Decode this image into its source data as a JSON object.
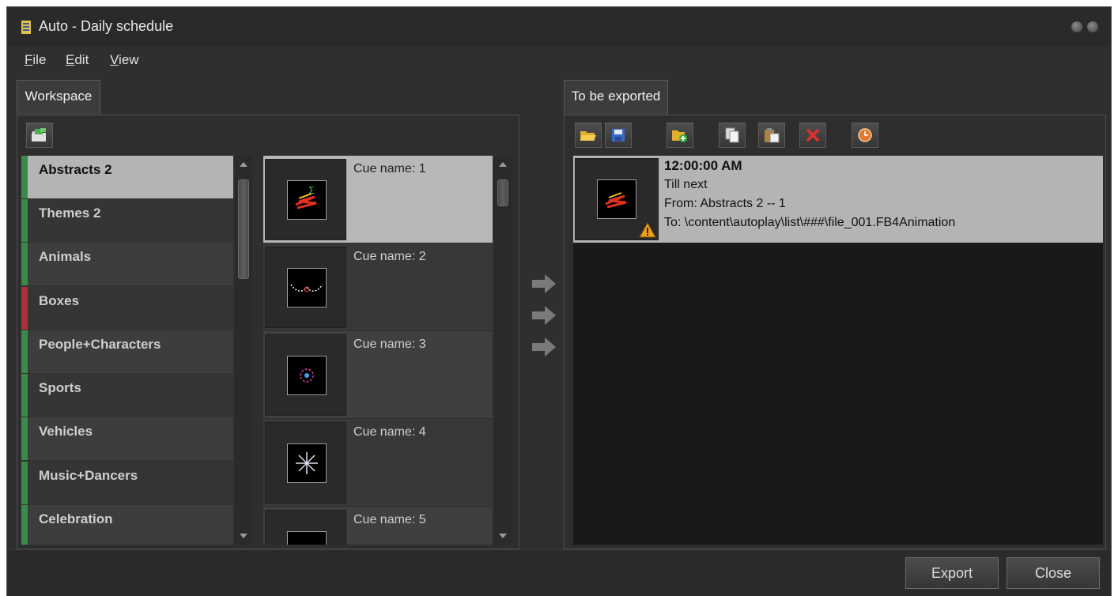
{
  "window": {
    "title": "Auto - Daily schedule",
    "icon": "app-icon",
    "controls": [
      "minimize-icon",
      "close-icon"
    ]
  },
  "menu": [
    {
      "label": "File",
      "mnemonic": "F",
      "rest": "ile"
    },
    {
      "label": "Edit",
      "mnemonic": "E",
      "rest": "dit"
    },
    {
      "label": "View",
      "mnemonic": "V",
      "rest": "iew"
    }
  ],
  "workspace": {
    "tab_label": "Workspace",
    "toolbar_icon": "open-folder-icon",
    "categories": [
      {
        "label": "Abstracts 2",
        "color": "#3a8a4a",
        "selected": true
      },
      {
        "label": "Themes 2",
        "color": "#3a8a4a"
      },
      {
        "label": "Animals",
        "color": "#3a8a4a"
      },
      {
        "label": "Boxes",
        "color": "#b0303a"
      },
      {
        "label": "People+Characters",
        "color": "#3a8a4a"
      },
      {
        "label": "Sports",
        "color": "#3a8a4a"
      },
      {
        "label": "Vehicles",
        "color": "#3a8a4a"
      },
      {
        "label": "Music+Dancers",
        "color": "#3a8a4a"
      },
      {
        "label": "Celebration",
        "color": "#3a8a4a"
      }
    ],
    "cues": [
      {
        "label": "Cue name: 1",
        "selected": true
      },
      {
        "label": "Cue name: 2"
      },
      {
        "label": "Cue name: 3"
      },
      {
        "label": "Cue name: 4"
      },
      {
        "label": "Cue name: 5"
      }
    ]
  },
  "transfer_icons": [
    "arrow-right-icon",
    "arrow-right-icon",
    "arrow-right-icon"
  ],
  "export": {
    "tab_label": "To be exported",
    "toolbar": [
      "open-icon",
      "save-icon",
      "add-icon",
      "copy-icon",
      "paste-icon",
      "delete-icon",
      "clock-icon"
    ],
    "entries": [
      {
        "time": "12:00:00 AM",
        "duration": "Till next",
        "from": "From: Abstracts 2 -- 1",
        "to": "To: \\content\\autoplay\\list\\###\\file_001.FB4Animation",
        "warning": true
      }
    ]
  },
  "buttons": {
    "export": "Export",
    "close": "Close"
  }
}
